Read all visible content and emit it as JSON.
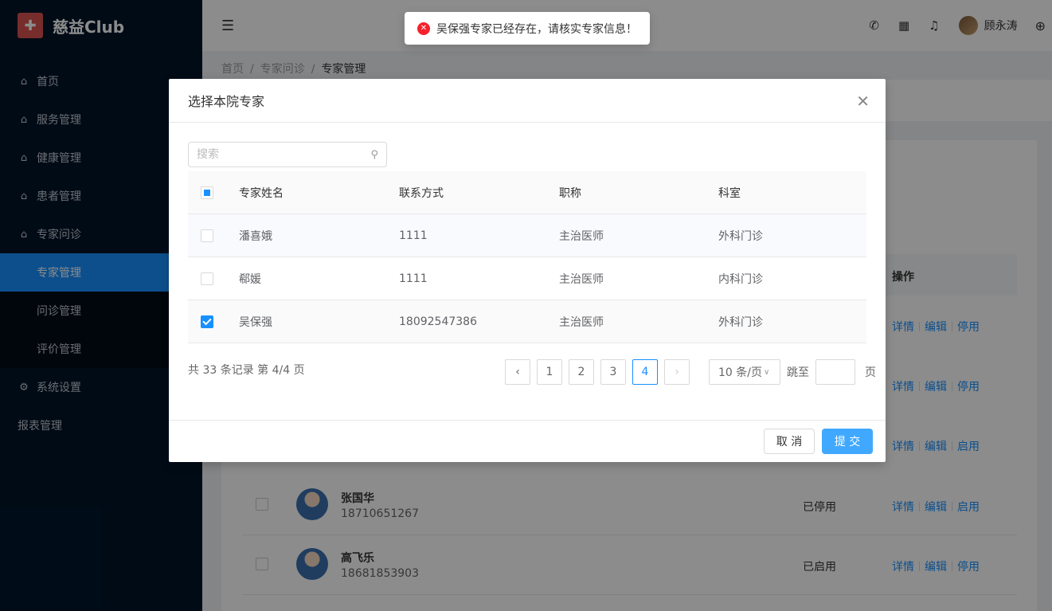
{
  "app": {
    "logo_text": "慈益Club"
  },
  "sidebar": {
    "items": [
      {
        "label": "首页"
      },
      {
        "label": "服务管理"
      },
      {
        "label": "健康管理"
      },
      {
        "label": "患者管理"
      },
      {
        "label": "专家问诊"
      },
      {
        "label": "专家管理"
      },
      {
        "label": "问诊管理"
      },
      {
        "label": "评价管理"
      },
      {
        "label": "系统设置"
      },
      {
        "label": "报表管理"
      }
    ]
  },
  "header": {
    "username": "顾永涛"
  },
  "breadcrumb": {
    "items": [
      "首页",
      "专家问诊",
      "专家管理"
    ]
  },
  "background_table": {
    "op_header": "操作",
    "ops": {
      "detail": "详情",
      "edit": "编辑",
      "disable": "停用",
      "enable": "启用"
    },
    "rows": [
      {
        "name": "张国华",
        "phone": "18710651267",
        "status": "已停用",
        "toggle": "启用"
      },
      {
        "name": "高飞乐",
        "phone": "18681853903",
        "status": "已启用",
        "toggle": "停用"
      }
    ],
    "partial_rows": [
      {
        "toggle": "停用"
      },
      {
        "toggle": "停用"
      },
      {
        "toggle": "启用"
      }
    ]
  },
  "modal": {
    "title": "选择本院专家",
    "search_placeholder": "搜索",
    "columns": [
      "专家姓名",
      "联系方式",
      "职称",
      "科室"
    ],
    "rows": [
      {
        "name": "潘喜娥",
        "phone": "1111",
        "title": "主治医师",
        "dept": "外科门诊",
        "checked": false
      },
      {
        "name": "郗媛",
        "phone": "1111",
        "title": "主治医师",
        "dept": "内科门诊",
        "checked": false
      },
      {
        "name": "吴保强",
        "phone": "18092547386",
        "title": "主治医师",
        "dept": "外科门诊",
        "checked": true
      }
    ],
    "total_text": "共 33 条记录 第 4/4 页",
    "pages": [
      "1",
      "2",
      "3",
      "4"
    ],
    "current_page": "4",
    "page_size": "10 条/页",
    "goto_label": "跳至",
    "goto_suffix": "页",
    "cancel_label": "取 消",
    "submit_label": "提 交"
  },
  "toast": {
    "message": "吴保强专家已经存在，请核实专家信息！",
    "type": "error"
  },
  "colors": {
    "primary": "#1890ff",
    "sidebar_bg": "#001529",
    "error": "#f5222d"
  }
}
